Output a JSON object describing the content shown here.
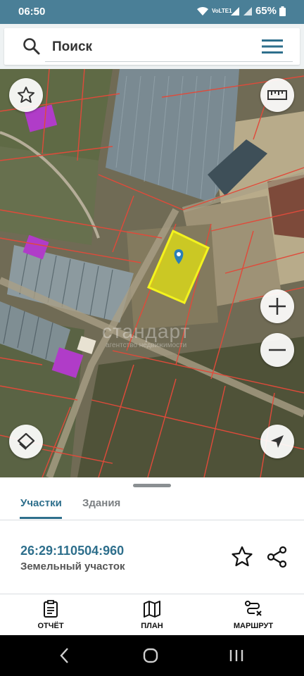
{
  "status": {
    "time": "06:50",
    "network": "VoLTE1",
    "battery": "65%"
  },
  "search": {
    "placeholder": "Поиск"
  },
  "map": {
    "watermark_title": "стандарт",
    "watermark_subtitle": "агентство недвижимости"
  },
  "tabs": [
    {
      "label": "Участки",
      "active": true
    },
    {
      "label": "Здания",
      "active": false
    }
  ],
  "parcel": {
    "id": "26:29:110504:960",
    "type": "Земельный участок"
  },
  "actions": [
    {
      "label": "ОТЧЁТ",
      "icon": "report-icon"
    },
    {
      "label": "ПЛАН",
      "icon": "map-plan-icon"
    },
    {
      "label": "МАРШРУТ",
      "icon": "route-icon"
    }
  ],
  "colors": {
    "accent": "#2e6f8c",
    "statusbar": "#4a7f97",
    "parcel_highlight": "#e6e600",
    "cadastral_lines": "#e04a3a"
  }
}
